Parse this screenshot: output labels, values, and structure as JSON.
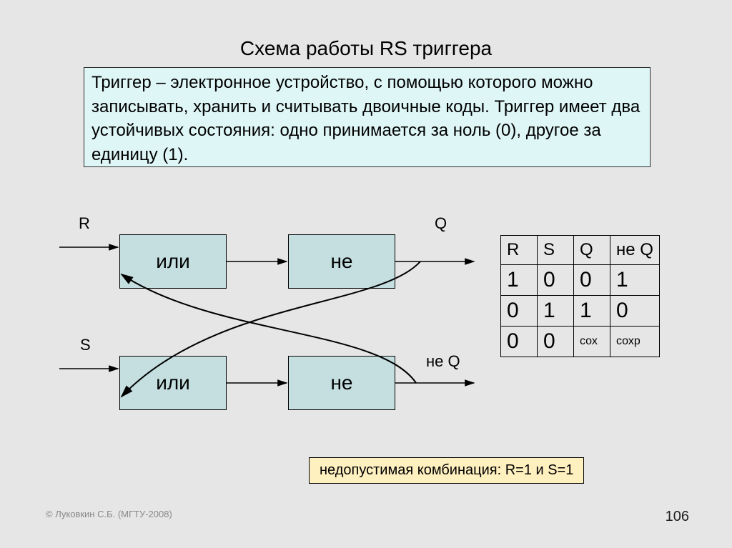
{
  "title": "Схема работы RS триггера",
  "definition": "Триггер – электронное устройство, с помощью которого можно записывать, хранить   и считывать двоичные коды. Триггер имеет два устойчивых состояния:\nодно принимается за ноль (0), другое за единицу (1).",
  "diagram": {
    "inputs": {
      "R": "R",
      "S": "S"
    },
    "outputs": {
      "Q": "Q",
      "notQ": "не Q"
    },
    "gates": {
      "or_top": "или",
      "not_top": "не",
      "or_bottom": "или",
      "not_bottom": "не"
    }
  },
  "chart_data": {
    "type": "table",
    "title": "Таблица истинности RS-триггера",
    "columns": [
      "R",
      "S",
      "Q",
      "не Q"
    ],
    "rows": [
      [
        "1",
        "0",
        "0",
        "1"
      ],
      [
        "0",
        "1",
        "1",
        "0"
      ],
      [
        "0",
        "0",
        "сох",
        "сохр"
      ]
    ]
  },
  "forbidden": "недопустимая комбинация: R=1 и S=1",
  "copyright": "© Луковкин С.Б. (МГТУ-2008)",
  "page_number": "106"
}
